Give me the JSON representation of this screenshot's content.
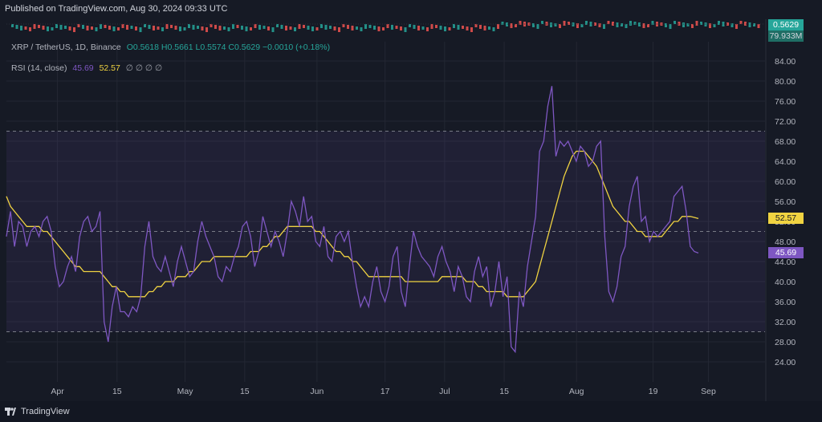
{
  "header": {
    "published": "Published on TradingView.com, Aug 30, 2024 09:33 UTC"
  },
  "legend": {
    "symbol": "XRP / TetherUS, 1D, Binance",
    "ohlc": "O0.5618 H0.5661 L0.5574 C0.5629 −0.0010 (+0.18%)",
    "indicator": "RSI (14, close)",
    "rsi_value": "45.69",
    "ma_value": "52.57",
    "flags": "∅ ∅ ∅ ∅"
  },
  "price": {
    "last_price": "0.5629",
    "volume": "79.933M",
    "colors": {
      "up": "#26a69a",
      "down": "#ef5350"
    }
  },
  "footer": {
    "brand": "TradingView"
  },
  "chart_data": {
    "type": "line",
    "title": "",
    "xlabel": "",
    "ylabel": "",
    "ylim": [
      21.6,
      84
    ],
    "x_start": "2024-03-20",
    "x_ticks": [
      {
        "label": "Apr",
        "date": "2024-04-01"
      },
      {
        "label": "15",
        "date": "2024-04-15"
      },
      {
        "label": "May",
        "date": "2024-05-01"
      },
      {
        "label": "15",
        "date": "2024-05-15"
      },
      {
        "label": "Jun",
        "date": "2024-06-01"
      },
      {
        "label": "17",
        "date": "2024-06-17"
      },
      {
        "label": "Jul",
        "date": "2024-07-01"
      },
      {
        "label": "15",
        "date": "2024-07-15"
      },
      {
        "label": "Aug",
        "date": "2024-08-01"
      },
      {
        "label": "19",
        "date": "2024-08-19"
      },
      {
        "label": "Sep",
        "date": "2024-09-01"
      }
    ],
    "y_ticks": [
      "84.00",
      "80.00",
      "76.00",
      "72.00",
      "68.00",
      "64.00",
      "60.00",
      "56.00",
      "52.00",
      "48.00",
      "44.00",
      "40.00",
      "36.00",
      "32.00",
      "28.00",
      "24.00"
    ],
    "bands": {
      "upper": 70,
      "middle": 50,
      "lower": 30
    },
    "grid": true,
    "colors": {
      "rsi": "#7e57c2",
      "ma": "#f0d341",
      "band_fill": "#7e57c2",
      "band_line": "#787b86"
    },
    "series": [
      {
        "name": "RSI (14, close)",
        "values": [
          49,
          54,
          47,
          52,
          51,
          47,
          50,
          51,
          49,
          52,
          53,
          50,
          43,
          39,
          40,
          43,
          45,
          42,
          49,
          52,
          53,
          50,
          51,
          54,
          32,
          28,
          35,
          39,
          34,
          34,
          33,
          35,
          34,
          37,
          47,
          52,
          45,
          43,
          42,
          45,
          42,
          39,
          44,
          47,
          44,
          41,
          42,
          48,
          52,
          49,
          47,
          45,
          41,
          40,
          43,
          42,
          45,
          47,
          51,
          52,
          49,
          43,
          46,
          53,
          50,
          47,
          50,
          48,
          45,
          50,
          56,
          54,
          51,
          57,
          52,
          53,
          48,
          47,
          51,
          45,
          44,
          49,
          50,
          48,
          50,
          44,
          39,
          35,
          37,
          35,
          40,
          43,
          38,
          36,
          39,
          45,
          47,
          38,
          35,
          43,
          50,
          47,
          45,
          44,
          43,
          41,
          45,
          47,
          44,
          42,
          38,
          43,
          41,
          37,
          36,
          42,
          45,
          41,
          43,
          35,
          38,
          44,
          37,
          41,
          27,
          26,
          38,
          35,
          43,
          48,
          53,
          66,
          68,
          75,
          79,
          65,
          68,
          67,
          68,
          66,
          64,
          67,
          66,
          63,
          64,
          67,
          68,
          49,
          38,
          36,
          39,
          45,
          47,
          55,
          59,
          61,
          52,
          53,
          48,
          50,
          49,
          50,
          51,
          52,
          57,
          58,
          59,
          54,
          47,
          46,
          45.69
        ],
        "last_value": "45.69"
      },
      {
        "name": "RSI-based MA",
        "values": [
          57,
          55,
          54,
          53,
          52,
          51,
          51,
          51,
          51,
          50,
          50,
          49,
          48,
          47,
          46,
          45,
          44,
          43,
          43,
          42,
          42,
          42,
          42,
          42,
          41,
          40,
          39,
          39,
          38,
          38,
          37,
          37,
          37,
          37,
          37,
          38,
          38,
          39,
          39,
          40,
          40,
          40,
          41,
          41,
          41,
          42,
          42,
          43,
          44,
          44,
          44,
          45,
          45,
          45,
          45,
          45,
          45,
          45,
          45,
          45,
          46,
          46,
          46,
          47,
          47,
          48,
          49,
          49,
          50,
          51,
          51,
          51,
          51,
          51,
          51,
          51,
          50,
          50,
          49,
          48,
          47,
          46,
          46,
          45,
          45,
          44,
          44,
          43,
          42,
          41,
          41,
          41,
          41,
          41,
          41,
          41,
          41,
          41,
          40,
          40,
          40,
          40,
          40,
          40,
          40,
          40,
          40,
          41,
          41,
          41,
          41,
          41,
          41,
          40,
          40,
          40,
          39,
          39,
          38,
          38,
          38,
          38,
          38,
          37,
          37,
          37,
          37,
          37,
          38,
          39,
          40,
          43,
          46,
          49,
          52,
          55,
          58,
          61,
          63,
          65,
          66,
          66,
          66,
          65,
          64,
          63,
          61,
          59,
          57,
          55,
          54,
          53,
          52,
          52,
          51,
          50,
          50,
          49,
          49,
          49,
          49,
          49,
          50,
          51,
          52,
          52,
          53,
          53,
          53,
          52.8,
          52.57
        ],
        "last_value": "52.57"
      }
    ]
  }
}
